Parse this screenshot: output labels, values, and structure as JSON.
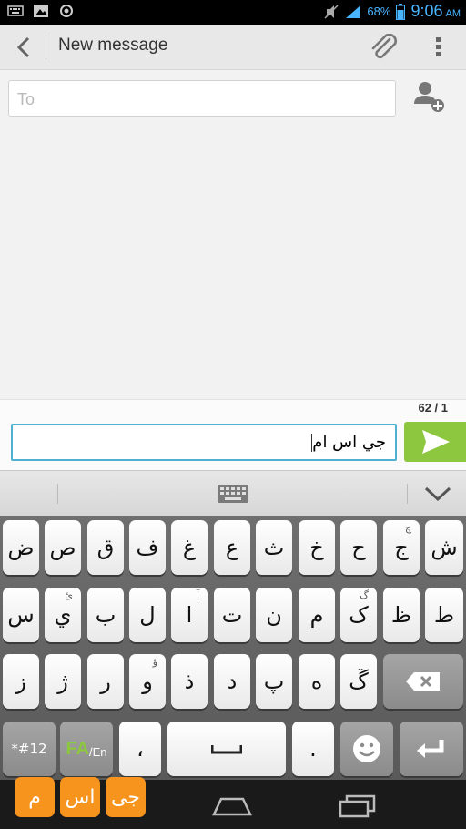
{
  "statusbar": {
    "icons_left": [
      "keyboard-icon",
      "image-icon",
      "camera-icon"
    ],
    "icons_right": [
      "mute-icon",
      "signal-icon",
      "battery-icon"
    ],
    "battery_percent": "68%",
    "time": "9:06",
    "ampm": "AM",
    "accent": "#49b4ff"
  },
  "actionbar": {
    "title": "New message"
  },
  "recipients": {
    "to_placeholder": "To"
  },
  "compose": {
    "counter": "62 / 1",
    "message_text": "جي اس ام",
    "send_color": "#8dc63f",
    "focus_color": "#4fb0d0"
  },
  "keyboard": {
    "row1": [
      "ض",
      "ص",
      "ق",
      "ف",
      "غ",
      "ع",
      "ث",
      "خ",
      "ح",
      "ج",
      "ش"
    ],
    "row1_hint_index": 9,
    "row1_hint": "چ",
    "row2": [
      "س",
      "ي",
      "ب",
      "ل",
      "ا",
      "ت",
      "ن",
      "م",
      "ک",
      "ظ",
      "ط"
    ],
    "row2_hints": {
      "1": "ئ",
      "4": "آ",
      "8": "گ"
    },
    "row3": [
      "ز",
      "ژ",
      "ر",
      "و",
      "ذ",
      "د",
      "پ",
      "ه",
      "ڱ"
    ],
    "row3_hints": {
      "3": "ؤ"
    },
    "bottom": {
      "symbols_label": "*#12",
      "lang_fa": "FA",
      "lang_en": "/En",
      "comma": "،",
      "period": "."
    }
  },
  "app_icons": [
    "م",
    "اس",
    "جی"
  ]
}
